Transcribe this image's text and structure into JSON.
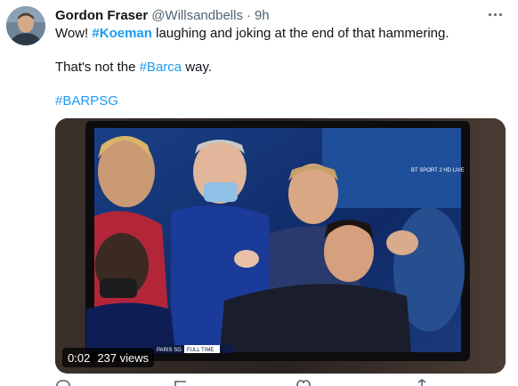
{
  "tweet": {
    "author_name": "Gordon Fraser",
    "author_handle": "@Willsandbells",
    "separator": "·",
    "time": "9h",
    "line1": {
      "prefix": "Wow! ",
      "hashtag": "#Koeman",
      "suffix": " laughing and joking at the end of that hammering."
    },
    "line2": {
      "prefix": "That's not the ",
      "hashtag": "#Barca",
      "suffix": " way."
    },
    "line3": {
      "hashtag": "#BARPSG"
    }
  },
  "video": {
    "timestamp": "0:02",
    "views": "237 views",
    "tv_logo": "BT SPORT 2 HD LIVE",
    "scoreboard": "PARIS SG",
    "scoreboard_status": "FULL TIME"
  },
  "icons": {
    "more": "more-dots-icon",
    "reply": "reply-icon",
    "retweet": "retweet-icon",
    "like": "like-icon",
    "share": "share-icon"
  },
  "colors": {
    "link": "#1d9bf0",
    "text": "#0f1419",
    "secondary": "#536471"
  }
}
